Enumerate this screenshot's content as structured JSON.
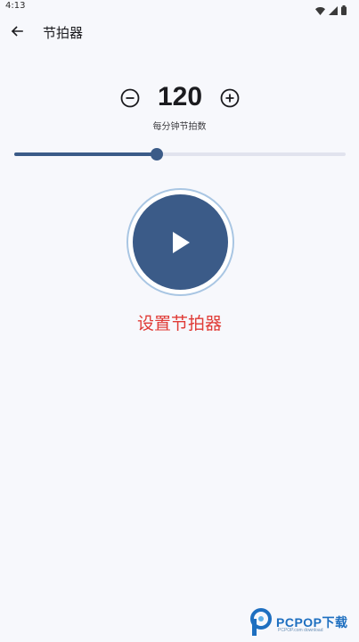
{
  "status_bar": {
    "time": "4:13",
    "icons": [
      "wifi-icon",
      "signal-icon",
      "battery-icon"
    ]
  },
  "app_bar": {
    "back_icon": "arrow-left-icon",
    "title": "节拍器"
  },
  "bpm": {
    "value": "120",
    "label": "每分钟节拍数",
    "minus_icon": "minus-circle-icon",
    "plus_icon": "plus-circle-icon"
  },
  "slider": {
    "fraction": 0.43
  },
  "play_button": {
    "icon": "play-icon"
  },
  "setup_link": {
    "label": "设置节拍器"
  },
  "watermark": {
    "brand": "PCPOP下载",
    "sub": "PCPOP.com download"
  },
  "colors": {
    "primary": "#3b5b88",
    "accent_red": "#e03b36",
    "background": "#f7f8fc",
    "track": "#e1e3ee",
    "ring": "#a9c6e3"
  }
}
